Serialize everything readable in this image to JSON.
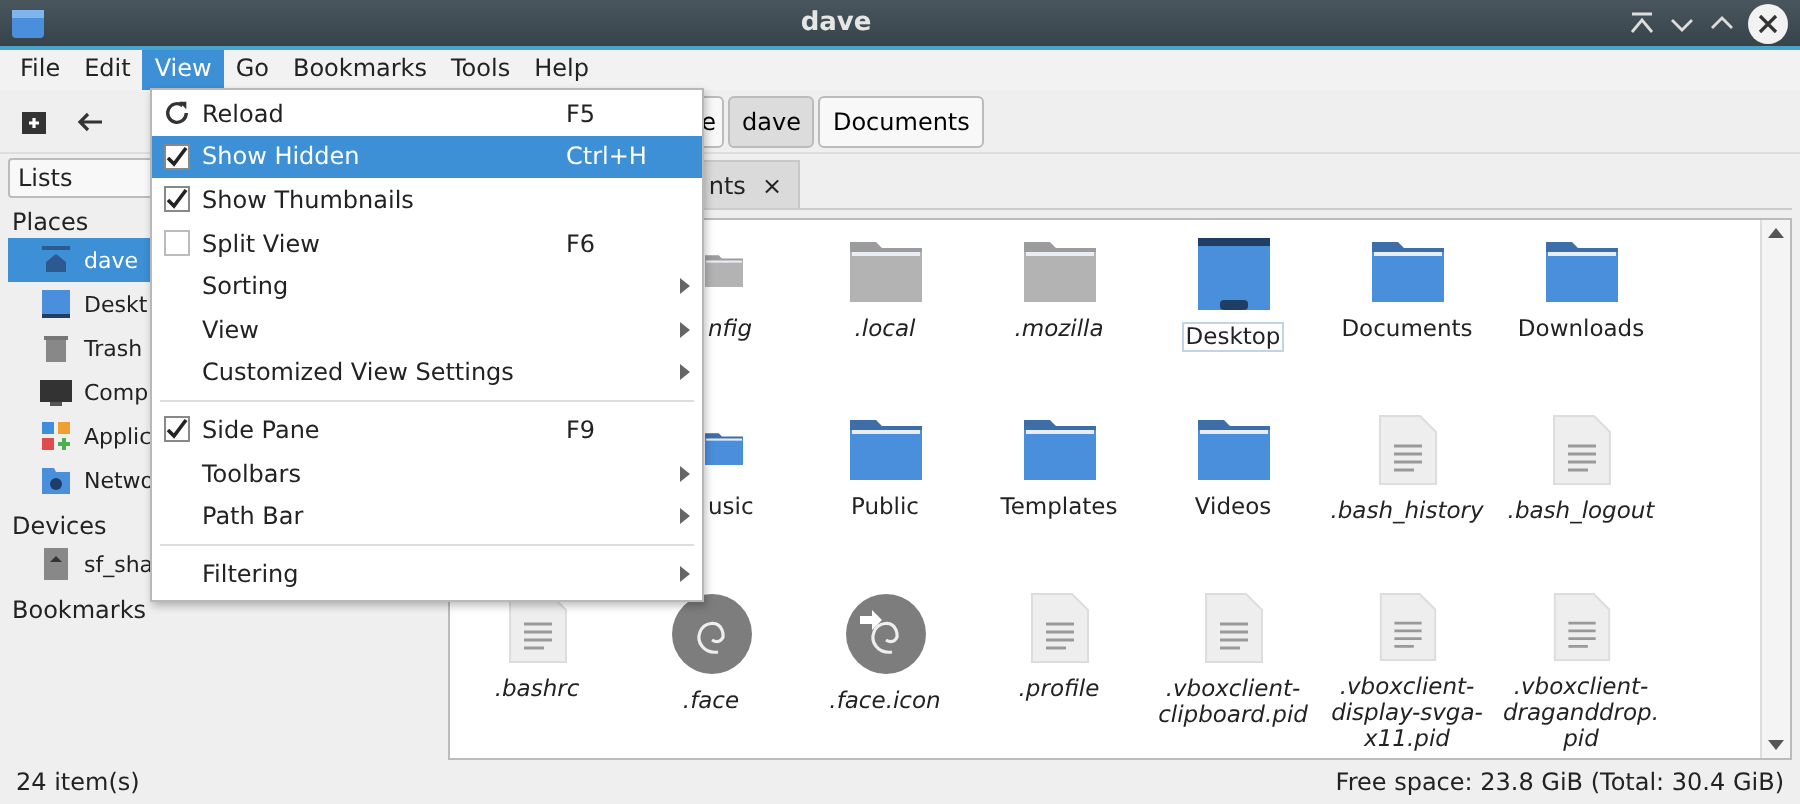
{
  "window": {
    "title": "dave"
  },
  "menubar": [
    {
      "label": "File",
      "selected": false
    },
    {
      "label": "Edit",
      "selected": false
    },
    {
      "label": "View",
      "selected": true
    },
    {
      "label": "Go",
      "selected": false
    },
    {
      "label": "Bookmarks",
      "selected": false
    },
    {
      "label": "Tools",
      "selected": false
    },
    {
      "label": "Help",
      "selected": false
    }
  ],
  "path_bar": [
    {
      "label": "e",
      "selected": false
    },
    {
      "label": "dave",
      "selected": true
    },
    {
      "label": "Documents",
      "selected": false
    }
  ],
  "sidebar": {
    "view_select": "Lists",
    "sections": [
      {
        "title": "Places",
        "items": [
          {
            "label": "dave",
            "kind": "home",
            "selected": true
          },
          {
            "label": "Deskt",
            "kind": "desktop",
            "selected": false
          },
          {
            "label": "Trash",
            "kind": "trash",
            "selected": false
          },
          {
            "label": "Comp",
            "kind": "computer",
            "selected": false
          },
          {
            "label": "Applic",
            "kind": "applications",
            "selected": false
          },
          {
            "label": "Netwo",
            "kind": "network",
            "selected": false
          }
        ]
      },
      {
        "title": "Devices",
        "items": [
          {
            "label": "sf_sha",
            "kind": "drive",
            "selected": false
          }
        ]
      },
      {
        "title": "Bookmarks"
      }
    ]
  },
  "tab": {
    "label": "nts",
    "close": "×"
  },
  "files": [
    [
      {
        "name": "nfig",
        "kind": "partial-folder",
        "hidden": true,
        "focused": false
      },
      {
        "name": ".local",
        "kind": "grey-folder",
        "hidden": true,
        "focused": false
      },
      {
        "name": ".mozilla",
        "kind": "grey-folder",
        "hidden": true,
        "focused": false
      },
      {
        "name": "Desktop",
        "kind": "desktop",
        "hidden": false,
        "focused": true
      },
      {
        "name": "Documents",
        "kind": "folder",
        "hidden": false,
        "focused": false
      },
      {
        "name": "Downloads",
        "kind": "folder",
        "hidden": false,
        "focused": false
      }
    ],
    [
      {
        "name": "usic",
        "kind": "partial-blue-folder",
        "hidden": false,
        "focused": false
      },
      {
        "name": "Public",
        "kind": "folder",
        "hidden": false,
        "focused": false
      },
      {
        "name": "Templates",
        "kind": "folder",
        "hidden": false,
        "focused": false
      },
      {
        "name": "Videos",
        "kind": "folder",
        "hidden": false,
        "focused": false
      },
      {
        "name": ".bash_history",
        "kind": "file",
        "hidden": true,
        "focused": false
      },
      {
        "name": ".bash_logout",
        "kind": "file",
        "hidden": true,
        "focused": false
      }
    ],
    [
      {
        "name": ".bashrc",
        "kind": "file",
        "hidden": true,
        "focused": false
      },
      {
        "name": ".face",
        "kind": "swirl",
        "hidden": true,
        "focused": false
      },
      {
        "name": ".face.icon",
        "kind": "swirl-link",
        "hidden": true,
        "focused": false
      },
      {
        "name": ".profile",
        "kind": "file",
        "hidden": true,
        "focused": false
      },
      {
        "name": ".vboxclient-clipboard.pid",
        "kind": "file",
        "hidden": true,
        "focused": false
      },
      {
        "name": ".vboxclient-display-svga-x11.pid",
        "kind": "file",
        "hidden": true,
        "focused": false
      },
      {
        "name": ".vboxclient-draganddrop.pid",
        "kind": "file",
        "hidden": true,
        "focused": false
      }
    ]
  ],
  "view_menu": [
    {
      "kind": "action",
      "label": "Reload",
      "shortcut": "F5",
      "selected": false
    },
    {
      "kind": "check",
      "label": "Show Hidden",
      "shortcut": "Ctrl+H",
      "checked": true,
      "selected": true
    },
    {
      "kind": "check",
      "label": "Show Thumbnails",
      "checked": true,
      "selected": false
    },
    {
      "kind": "check",
      "label": "Split View",
      "shortcut": "F6",
      "checked": false,
      "selected": false
    },
    {
      "kind": "submenu",
      "label": "Sorting",
      "selected": false
    },
    {
      "kind": "submenu",
      "label": "View",
      "selected": false
    },
    {
      "kind": "submenu",
      "label": "Customized View Settings",
      "selected": false
    },
    {
      "kind": "separator"
    },
    {
      "kind": "check",
      "label": "Side Pane",
      "shortcut": "F9",
      "checked": true,
      "selected": false
    },
    {
      "kind": "submenu",
      "label": "Toolbars",
      "selected": false
    },
    {
      "kind": "submenu",
      "label": "Path Bar",
      "selected": false
    },
    {
      "kind": "separator"
    },
    {
      "kind": "submenu",
      "label": "Filtering",
      "selected": false
    }
  ],
  "status_bar": {
    "items": "24 item(s)",
    "free_space": "Free space: 23.8 GiB (Total: 30.4 GiB)"
  }
}
